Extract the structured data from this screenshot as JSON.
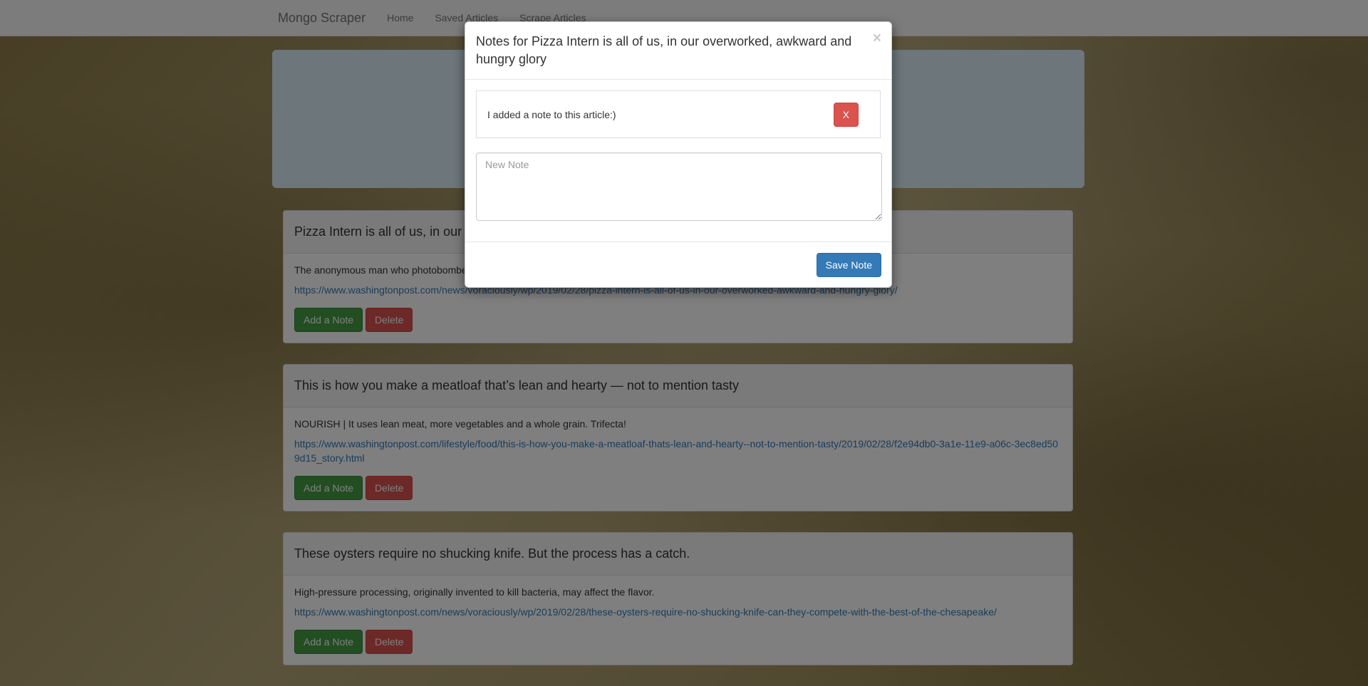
{
  "navbar": {
    "brand": "Mongo Scraper",
    "links": [
      "Home",
      "Saved Articles",
      "Scrape Articles"
    ]
  },
  "articles": [
    {
      "title": "Pizza Intern is all of us, in our overworked, awkward and hungry glory",
      "summary": "The anonymous man who photobombed",
      "url": "https://www.washingtonpost.com/news/voraciously/wp/2019/02/28/pizza-intern-is-all-of-us-in-our-overworked-awkward-and-hungry-glory/"
    },
    {
      "title": "This is how you make a meatloaf that’s lean and hearty — not to mention tasty",
      "summary": "NOURISH | It uses lean meat, more vegetables and a whole grain. Trifecta!",
      "url": "https://www.washingtonpost.com/lifestyle/food/this-is-how-you-make-a-meatloaf-thats-lean-and-hearty--not-to-mention-tasty/2019/02/28/f2e94db0-3a1e-11e9-a06c-3ec8ed509d15_story.html"
    },
    {
      "title": "These oysters require no shucking knife. But the process has a catch.",
      "summary": "High-pressure processing, originally invented to kill bacteria, may affect the flavor.",
      "url": "https://www.washingtonpost.com/news/voraciously/wp/2019/02/28/these-oysters-require-no-shucking-knife-can-they-compete-with-the-best-of-the-chesapeake/"
    }
  ],
  "article_buttons": {
    "add_note": "Add a Note",
    "delete": "Delete"
  },
  "modal": {
    "title": "Notes for Pizza Intern is all of us, in our overworked, awkward and hungry glory",
    "close": "×",
    "notes": [
      {
        "text": "I added a note to this article:)",
        "delete_label": "X"
      }
    ],
    "new_note_placeholder": "New Note",
    "save_label": "Save Note"
  },
  "colors": {
    "success": "#449d44",
    "danger": "#d9534f",
    "primary": "#337ab7",
    "jumbotron": "#d9edf7"
  }
}
